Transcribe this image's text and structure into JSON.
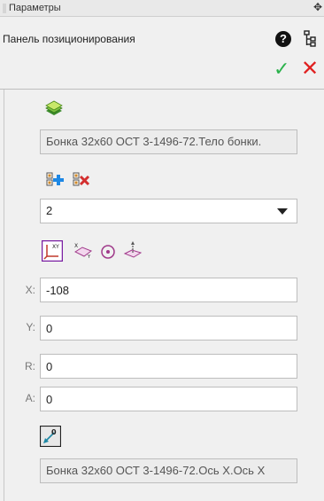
{
  "window": {
    "title": "Параметры"
  },
  "panel": {
    "title": "Панель позиционирования"
  },
  "body_ref": {
    "value": "Бонка 32x60 ОСТ 3-1496-72.Тело бонки."
  },
  "lcs_select": {
    "value": "2"
  },
  "fields": {
    "x": {
      "label": "X:",
      "value": "-108"
    },
    "y": {
      "label": "Y:",
      "value": "0"
    },
    "r": {
      "label": "R:",
      "value": "0"
    },
    "a": {
      "label": "A:",
      "value": "0"
    }
  },
  "axis_ref": {
    "value": "Бонка 32x60 ОСТ 3-1496-72.Ось X.Ось X"
  },
  "icons": [
    "grip-icon",
    "pin-icon",
    "help-icon",
    "tree-icon",
    "ok-icon",
    "cancel-icon",
    "layers-icon",
    "add-lcs-icon",
    "remove-lcs-icon",
    "cartesian-icon",
    "plane-icon",
    "point-icon",
    "normal-icon",
    "axis-select-icon"
  ],
  "colors": {
    "accent_ok": "#2bb24c",
    "accent_cancel": "#e02020",
    "active_outline": "#7a1fa2"
  }
}
